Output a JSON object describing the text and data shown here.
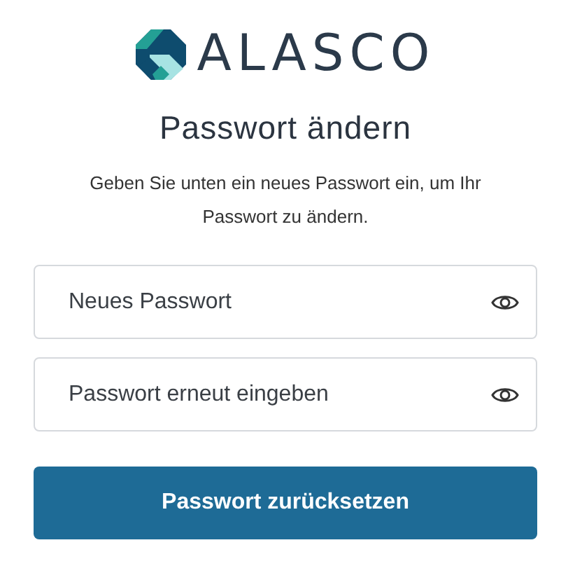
{
  "logo": {
    "text": "ALASCO"
  },
  "title": "Passwort ändern",
  "description": "Geben Sie unten ein neues Passwort ein, um Ihr Passwort zu ändern.",
  "fields": [
    {
      "placeholder": "Neues Passwort"
    },
    {
      "placeholder": "Passwort erneut eingeben"
    }
  ],
  "submit": "Passwort zurücksetzen"
}
